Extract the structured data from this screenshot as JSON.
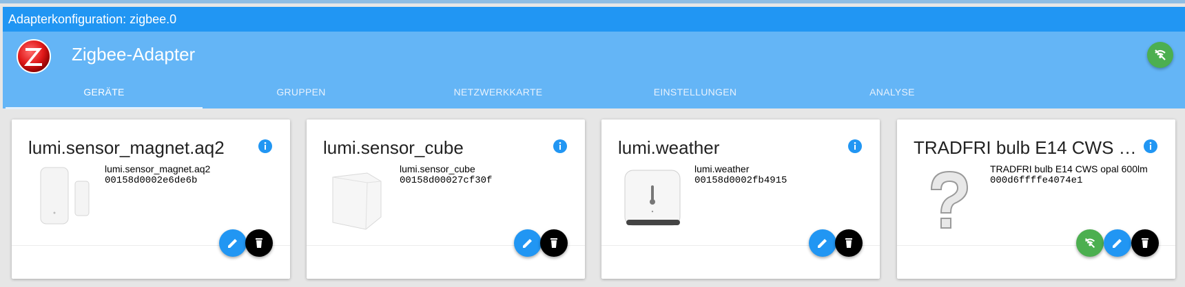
{
  "window": {
    "title": "Adapterkonfiguration: zigbee.0"
  },
  "header": {
    "app_title": "Zigbee-Adapter",
    "status_icon": "wifi-icon",
    "status_color": "#4caf50"
  },
  "tabs": [
    {
      "label": "GERÄTE",
      "active": true
    },
    {
      "label": "GRUPPEN",
      "active": false
    },
    {
      "label": "NETZWERKKARTE",
      "active": false
    },
    {
      "label": "EINSTELLUNGEN",
      "active": false
    },
    {
      "label": "ANALYSE",
      "active": false
    }
  ],
  "devices": [
    {
      "title": "lumi.sensor_magnet.aq2",
      "model": "lumi.sensor_magnet.aq2",
      "id": "00158d0002e6de6b",
      "image": "door-sensor"
    },
    {
      "title": "lumi.sensor_cube",
      "model": "lumi.sensor_cube",
      "id": "00158d00027cf30f",
      "image": "cube"
    },
    {
      "title": "lumi.weather",
      "model": "lumi.weather",
      "id": "00158d0002fb4915",
      "image": "weather-sensor"
    },
    {
      "title": "TRADFRI bulb E14 CWS opal 600lm",
      "model": "TRADFRI bulb E14 CWS opal 600lm",
      "id": "000d6ffffe4074e1",
      "image": "unknown-question-mark"
    }
  ],
  "colors": {
    "accent": "#2196f3",
    "header": "#64b5f6",
    "success": "#4caf50"
  }
}
